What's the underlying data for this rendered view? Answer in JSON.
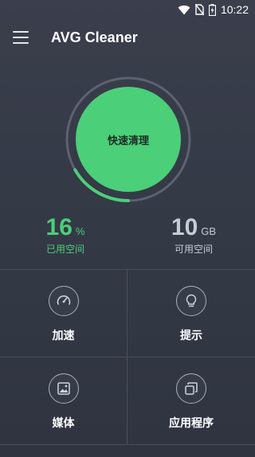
{
  "status_bar": {
    "time": "10:22",
    "icons": [
      "wifi-icon",
      "no-sim-icon",
      "battery-charging-icon"
    ]
  },
  "app_bar": {
    "menu_icon": "hamburger-menu-icon",
    "title": "AVG Cleaner"
  },
  "cleaner": {
    "button_label": "快速清理",
    "progress_fraction": 0.16,
    "accent_color": "#4ccf79"
  },
  "storage": {
    "used_value": "16",
    "used_unit": "%",
    "used_caption": "已用空间",
    "free_value": "10",
    "free_unit": "GB",
    "free_caption": "可用空间"
  },
  "tiles": [
    {
      "label": "加速",
      "icon": "speedometer-icon"
    },
    {
      "label": "提示",
      "icon": "lightbulb-icon"
    },
    {
      "label": "媒体",
      "icon": "photo-icon"
    },
    {
      "label": "应用程序",
      "icon": "apps-icon"
    }
  ]
}
